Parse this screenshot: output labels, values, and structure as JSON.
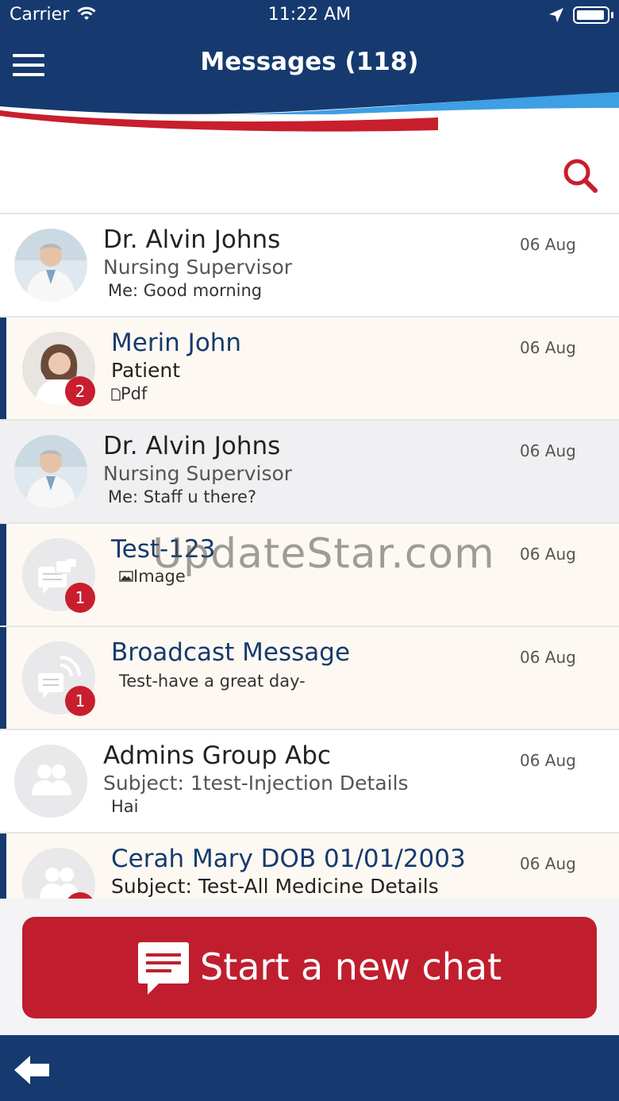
{
  "status_bar": {
    "carrier": "Carrier",
    "time": "11:22 AM"
  },
  "header": {
    "title": "Messages (118)"
  },
  "icons": {
    "menu": "hamburger-menu-icon",
    "search": "search-icon",
    "back": "back-arrow-icon",
    "chat": "chat-bubble-icon"
  },
  "colors": {
    "brand_blue": "#163a6f",
    "accent_red": "#c01e2e",
    "unread_bg": "#fdf9f2"
  },
  "conversations": [
    {
      "name": "Dr. Alvin Johns",
      "subtitle": "Nursing Supervisor",
      "preview": "Me: Good morning",
      "date": "06 Aug",
      "avatar": "doctor-photo",
      "unread": false
    },
    {
      "name": "Merin John",
      "subtitle": "Patient",
      "preview": "Pdf",
      "preview_icon": "document-icon",
      "date": "06 Aug",
      "avatar": "patient-photo",
      "unread": true,
      "badge": "2"
    },
    {
      "name": "Dr. Alvin Johns",
      "subtitle": "Nursing Supervisor",
      "preview": "Me: Staff u there?",
      "date": "06 Aug",
      "avatar": "doctor-photo",
      "unread": false
    },
    {
      "name": "Test-123",
      "subtitle": "",
      "preview": "Image",
      "preview_icon": "image-icon",
      "date": "06 Aug",
      "avatar": "secure-chat-icon",
      "unread": true,
      "badge": "1"
    },
    {
      "name": "Broadcast Message",
      "subtitle": "",
      "preview": "Test-have a great day-",
      "date": "06 Aug",
      "avatar": "broadcast-icon",
      "unread": true,
      "badge": "1"
    },
    {
      "name": "Admins Group Abc",
      "subtitle": "Subject: 1test-Injection Details",
      "preview": "Hai",
      "date": "06 Aug",
      "avatar": "group-icon",
      "unread": false
    },
    {
      "name": "Cerah Mary DOB 01/01/2003",
      "subtitle": "Subject: Test-All Medicine Details",
      "preview": "",
      "date": "06 Aug",
      "avatar": "group-icon",
      "unread": true
    }
  ],
  "watermark": "UpdateStar.com",
  "new_chat": {
    "label": "Start a new chat"
  }
}
